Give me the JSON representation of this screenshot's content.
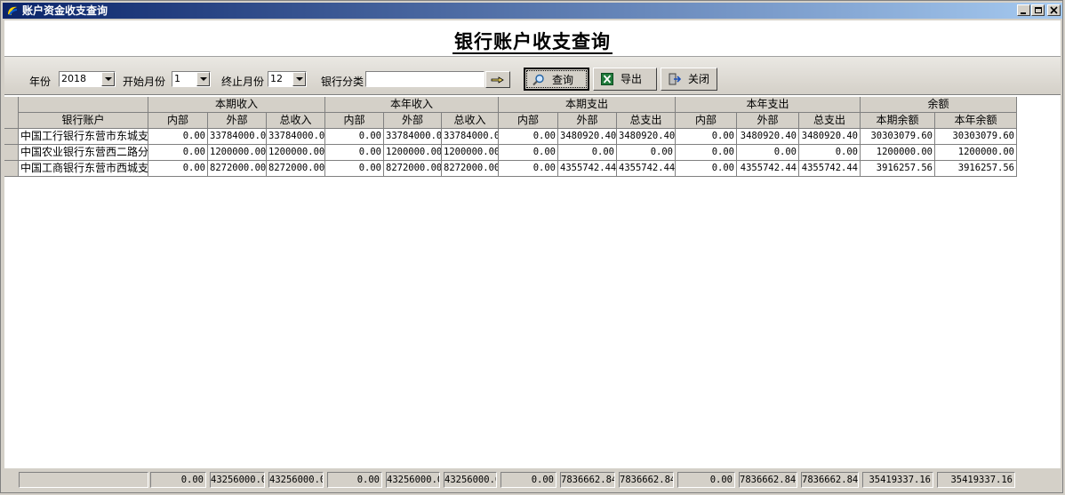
{
  "window": {
    "title": "账户资金收支查询",
    "buttons": [
      "_",
      "□",
      "×"
    ]
  },
  "heading": "银行账户收支查询",
  "toolbar": {
    "year_label": "年份",
    "year_value": "2018",
    "start_month_label": "开始月份",
    "start_month_value": "1",
    "end_month_label": "终止月份",
    "end_month_value": "12",
    "bank_category_label": "银行分类",
    "bank_category_value": "",
    "query_label": "查询",
    "export_label": "导出",
    "close_label": "关闭"
  },
  "grid": {
    "groups": [
      "本期收入",
      "本年收入",
      "本期支出",
      "本年支出",
      "余额"
    ],
    "columns": [
      "银行账户",
      "内部",
      "外部",
      "总收入",
      "内部",
      "外部",
      "总收入",
      "内部",
      "外部",
      "总支出",
      "内部",
      "外部",
      "总支出",
      "本期余额",
      "本年余额"
    ],
    "rows": [
      [
        "中国工行银行东营市东城支",
        "0.00",
        "33784000.00",
        "33784000.00",
        "0.00",
        "33784000.0",
        "33784000.0",
        "0.00",
        "3480920.40",
        "3480920.40",
        "0.00",
        "3480920.40",
        "3480920.40",
        "30303079.60",
        "30303079.60"
      ],
      [
        "中国农业银行东营西二路分",
        "0.00",
        "1200000.00",
        "1200000.00",
        "0.00",
        "1200000.00",
        "1200000.00",
        "0.00",
        "0.00",
        "0.00",
        "0.00",
        "0.00",
        "0.00",
        "1200000.00",
        "1200000.00"
      ],
      [
        "中国工商银行东营市西城支",
        "0.00",
        "8272000.00",
        "8272000.00",
        "0.00",
        "8272000.00",
        "8272000.00",
        "0.00",
        "4355742.44",
        "4355742.44",
        "0.00",
        "4355742.44",
        "4355742.44",
        "3916257.56",
        "3916257.56"
      ]
    ],
    "totals": [
      "0.00",
      "43256000.0",
      "43256000.0",
      "0.00",
      "43256000.0",
      "43256000.0",
      "0.00",
      "7836662.84",
      "7836662.84",
      "0.00",
      "7836662.84",
      "7836662.84",
      "35419337.16",
      "35419337.16"
    ]
  },
  "icons": {
    "app": "app-logo-icon",
    "query": "magnifier-icon",
    "export": "excel-icon",
    "close": "exit-door-icon",
    "bank_pick": "pointing-hand-icon"
  }
}
